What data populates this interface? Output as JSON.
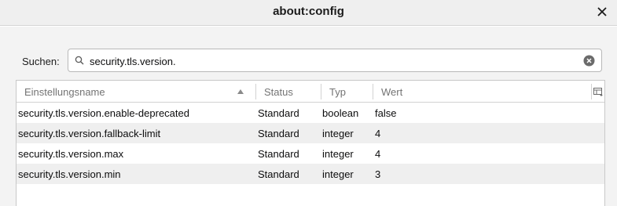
{
  "window": {
    "title": "about:config"
  },
  "search": {
    "label": "Suchen:",
    "value": "security.tls.version."
  },
  "table": {
    "headers": {
      "name": "Einstellungsname",
      "status": "Status",
      "type": "Typ",
      "value": "Wert"
    },
    "sort": "ascending",
    "rows": [
      {
        "name": "security.tls.version.enable-deprecated",
        "status": "Standard",
        "type": "boolean",
        "value": "false"
      },
      {
        "name": "security.tls.version.fallback-limit",
        "status": "Standard",
        "type": "integer",
        "value": "4"
      },
      {
        "name": "security.tls.version.max",
        "status": "Standard",
        "type": "integer",
        "value": "4"
      },
      {
        "name": "security.tls.version.min",
        "status": "Standard",
        "type": "integer",
        "value": "3"
      }
    ]
  },
  "icons": {
    "close": "close-icon",
    "search": "search-icon",
    "clear": "clear-search-icon",
    "sort": "sort-ascending-icon",
    "column_picker": "column-picker-icon"
  }
}
